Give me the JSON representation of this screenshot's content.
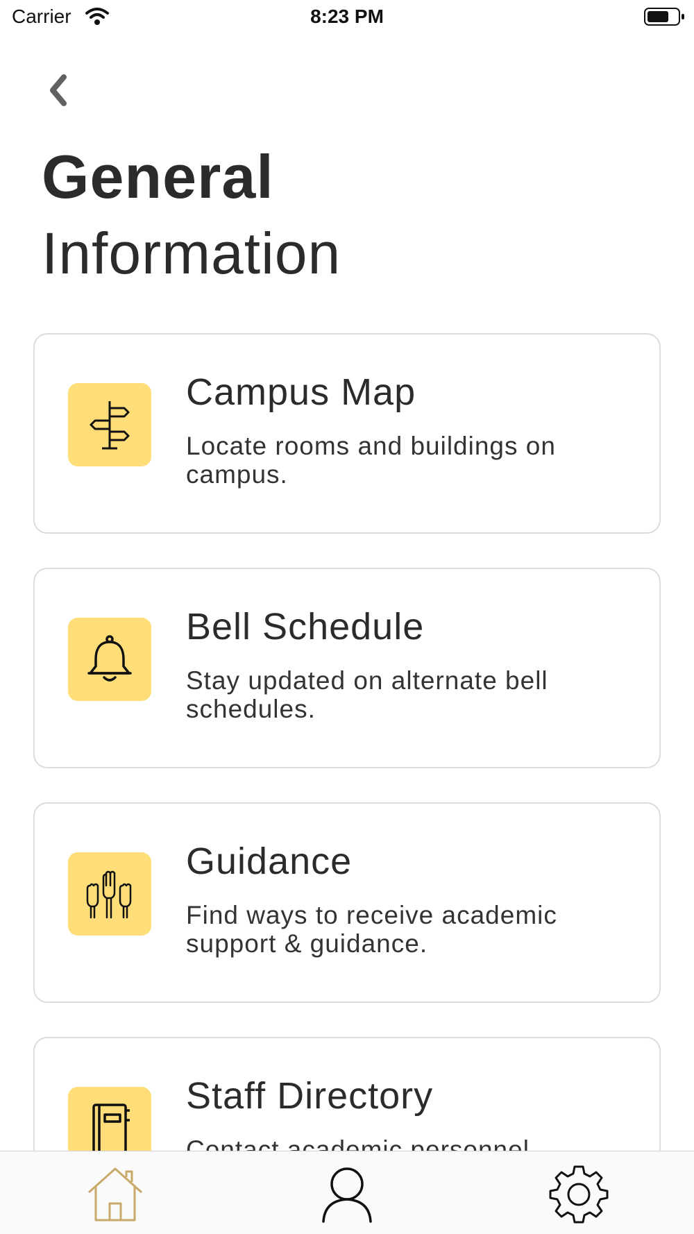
{
  "status_bar": {
    "carrier": "Carrier",
    "time": "8:23 PM",
    "wifi_icon": "wifi-icon",
    "battery_icon": "battery-icon"
  },
  "header": {
    "back_icon": "chevron-left-icon",
    "title_line1": "General",
    "title_line2": "Information"
  },
  "cards": [
    {
      "title": "Campus Map",
      "description": "Locate rooms and buildings on campus.",
      "icon": "signpost-icon"
    },
    {
      "title": "Bell Schedule",
      "description": "Stay updated on alternate bell schedules.",
      "icon": "bell-icon"
    },
    {
      "title": "Guidance",
      "description": "Find ways to receive academic support & guidance.",
      "icon": "raised-hands-icon"
    },
    {
      "title": "Staff Directory",
      "description": "Contact academic personnel",
      "icon": "directory-book-icon"
    }
  ],
  "tab_bar": {
    "tabs": [
      {
        "icon": "home-icon",
        "active": true
      },
      {
        "icon": "person-icon",
        "active": false
      },
      {
        "icon": "gear-icon",
        "active": false
      }
    ]
  },
  "colors": {
    "accent": "#ffdd78",
    "active_tab": "#c9a968",
    "text": "#2b2b2b",
    "card_border": "#dcdcdc"
  }
}
